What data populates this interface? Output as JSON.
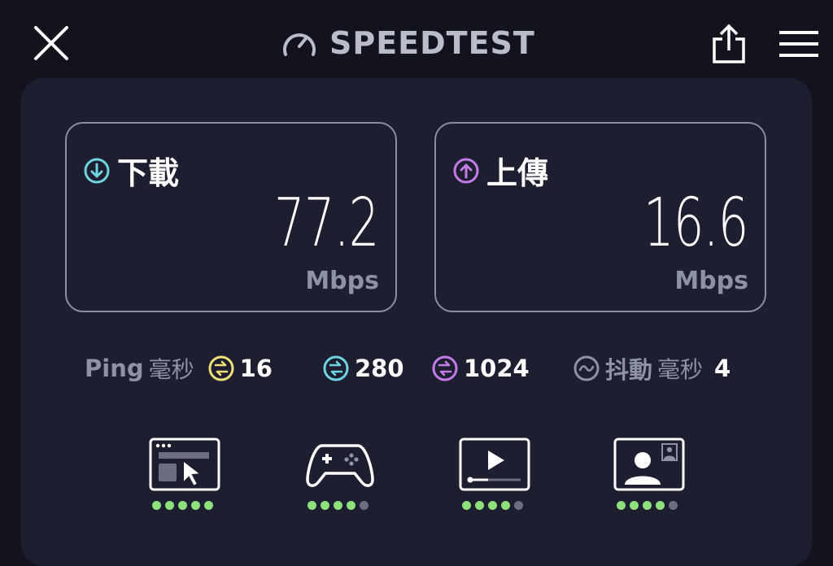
{
  "header": {
    "title": "SPEEDTEST"
  },
  "download": {
    "label": "下載",
    "value": "77.2",
    "unit": "Mbps"
  },
  "upload": {
    "label": "上傳",
    "value": "16.6",
    "unit": "Mbps"
  },
  "ping": {
    "label": "Ping",
    "unit": "毫秒",
    "idle": "16",
    "download": "280",
    "upload": "1024"
  },
  "jitter": {
    "label": "抖動",
    "unit": "毫秒",
    "value": "4"
  },
  "usage_ratings": [
    {
      "icon": "web-browsing-icon",
      "rating": 5,
      "max": 5
    },
    {
      "icon": "gaming-controller-icon",
      "rating": 4,
      "max": 5
    },
    {
      "icon": "video-streaming-icon",
      "rating": 4,
      "max": 5
    },
    {
      "icon": "video-call-icon",
      "rating": 4,
      "max": 5
    }
  ],
  "colors": {
    "background": "#12131c",
    "panel": "#1d1f30",
    "download_accent": "#6fd3e2",
    "upload_accent": "#c27ce8",
    "ping_idle_accent": "#efe07a",
    "rating_on": "#8ee07a",
    "rating_off": "#6b6e80",
    "muted_text": "#8e92a5"
  }
}
